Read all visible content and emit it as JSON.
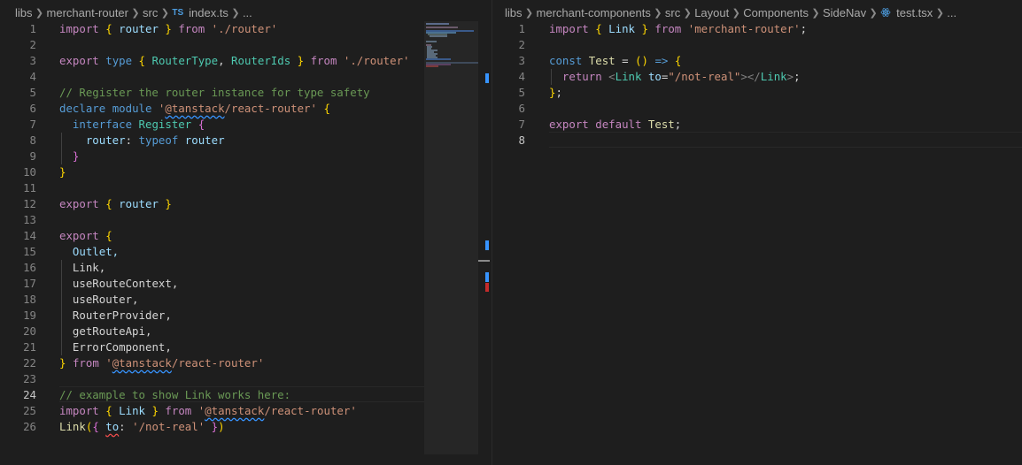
{
  "left_editor": {
    "breadcrumb": [
      "libs",
      "merchant-router",
      "src"
    ],
    "file_icon": "TS",
    "file_name": "index.ts",
    "breadcrumb_tail": "...",
    "line_numbers": [
      "1",
      "2",
      "3",
      "4",
      "5",
      "6",
      "7",
      "8",
      "9",
      "10",
      "11",
      "12",
      "13",
      "14",
      "15",
      "16",
      "17",
      "18",
      "19",
      "20",
      "21",
      "22",
      "23",
      "24",
      "25",
      "26"
    ],
    "active_line": "24",
    "code": {
      "l1": [
        "import",
        "{",
        "router",
        "}",
        "from",
        "'./router'"
      ],
      "l3": [
        "export",
        "type",
        "{",
        "RouterType",
        ",",
        "RouterIds",
        "}",
        "from",
        "'./router'"
      ],
      "l5": "// Register the router instance for type safety",
      "l6": [
        "declare",
        "module",
        "'",
        "@tanstack",
        "/react-router'",
        "{"
      ],
      "l7": [
        "interface",
        "Register",
        "{"
      ],
      "l8": [
        "router",
        ":",
        "typeof",
        "router"
      ],
      "l9": "}",
      "l10": "}",
      "l12": [
        "export",
        "{",
        "router",
        "}"
      ],
      "l14": [
        "export",
        "{"
      ],
      "exports": [
        "Outlet,",
        "Link,",
        "useRouteContext,",
        "useRouter,",
        "RouterProvider,",
        "getRouteApi,",
        "ErrorComponent,"
      ],
      "l22": [
        "}",
        "from",
        "'",
        "@tanstack",
        "/react-router'"
      ],
      "l24": "// example to show Link works here:",
      "l25": [
        "import",
        "{",
        "Link",
        "}",
        "from",
        "'",
        "@tanstack",
        "/react-router'"
      ],
      "l26": [
        "Link",
        "(",
        "{",
        "to",
        ":",
        "'/not-real'",
        "}",
        ")"
      ]
    }
  },
  "right_editor": {
    "breadcrumb": [
      "libs",
      "merchant-components",
      "src",
      "Layout",
      "Components",
      "SideNav"
    ],
    "file_icon": "react-icon",
    "file_name": "test.tsx",
    "breadcrumb_tail": "...",
    "line_numbers": [
      "1",
      "2",
      "3",
      "4",
      "5",
      "6",
      "7",
      "8"
    ],
    "active_line": "8",
    "code": {
      "l1": [
        "import",
        "{",
        "Link",
        "}",
        "from",
        "'merchant-router'",
        ";"
      ],
      "l3": [
        "const",
        "Test",
        "=",
        "(",
        ")",
        "=>",
        "{"
      ],
      "l4": [
        "return",
        "<",
        "Link",
        "to",
        "=",
        "\"/not-real\"",
        "></",
        "Link",
        ">",
        ";"
      ],
      "l5": [
        "}",
        ";"
      ],
      "l7": [
        "export",
        "default",
        "Test",
        ";"
      ]
    }
  },
  "colors": {
    "background": "#1e1e1e",
    "keyword": "#c586c0",
    "storage": "#569cd6",
    "variable": "#9cdcfe",
    "type": "#4ec9b0",
    "string": "#ce9178",
    "comment": "#6a9955",
    "function": "#dcdcaa",
    "bracket_1": "#ffd700",
    "bracket_2": "#da70d6",
    "bracket_3": "#179fff",
    "info_squiggle": "#3794ff",
    "error_squiggle": "#f14c4c"
  }
}
